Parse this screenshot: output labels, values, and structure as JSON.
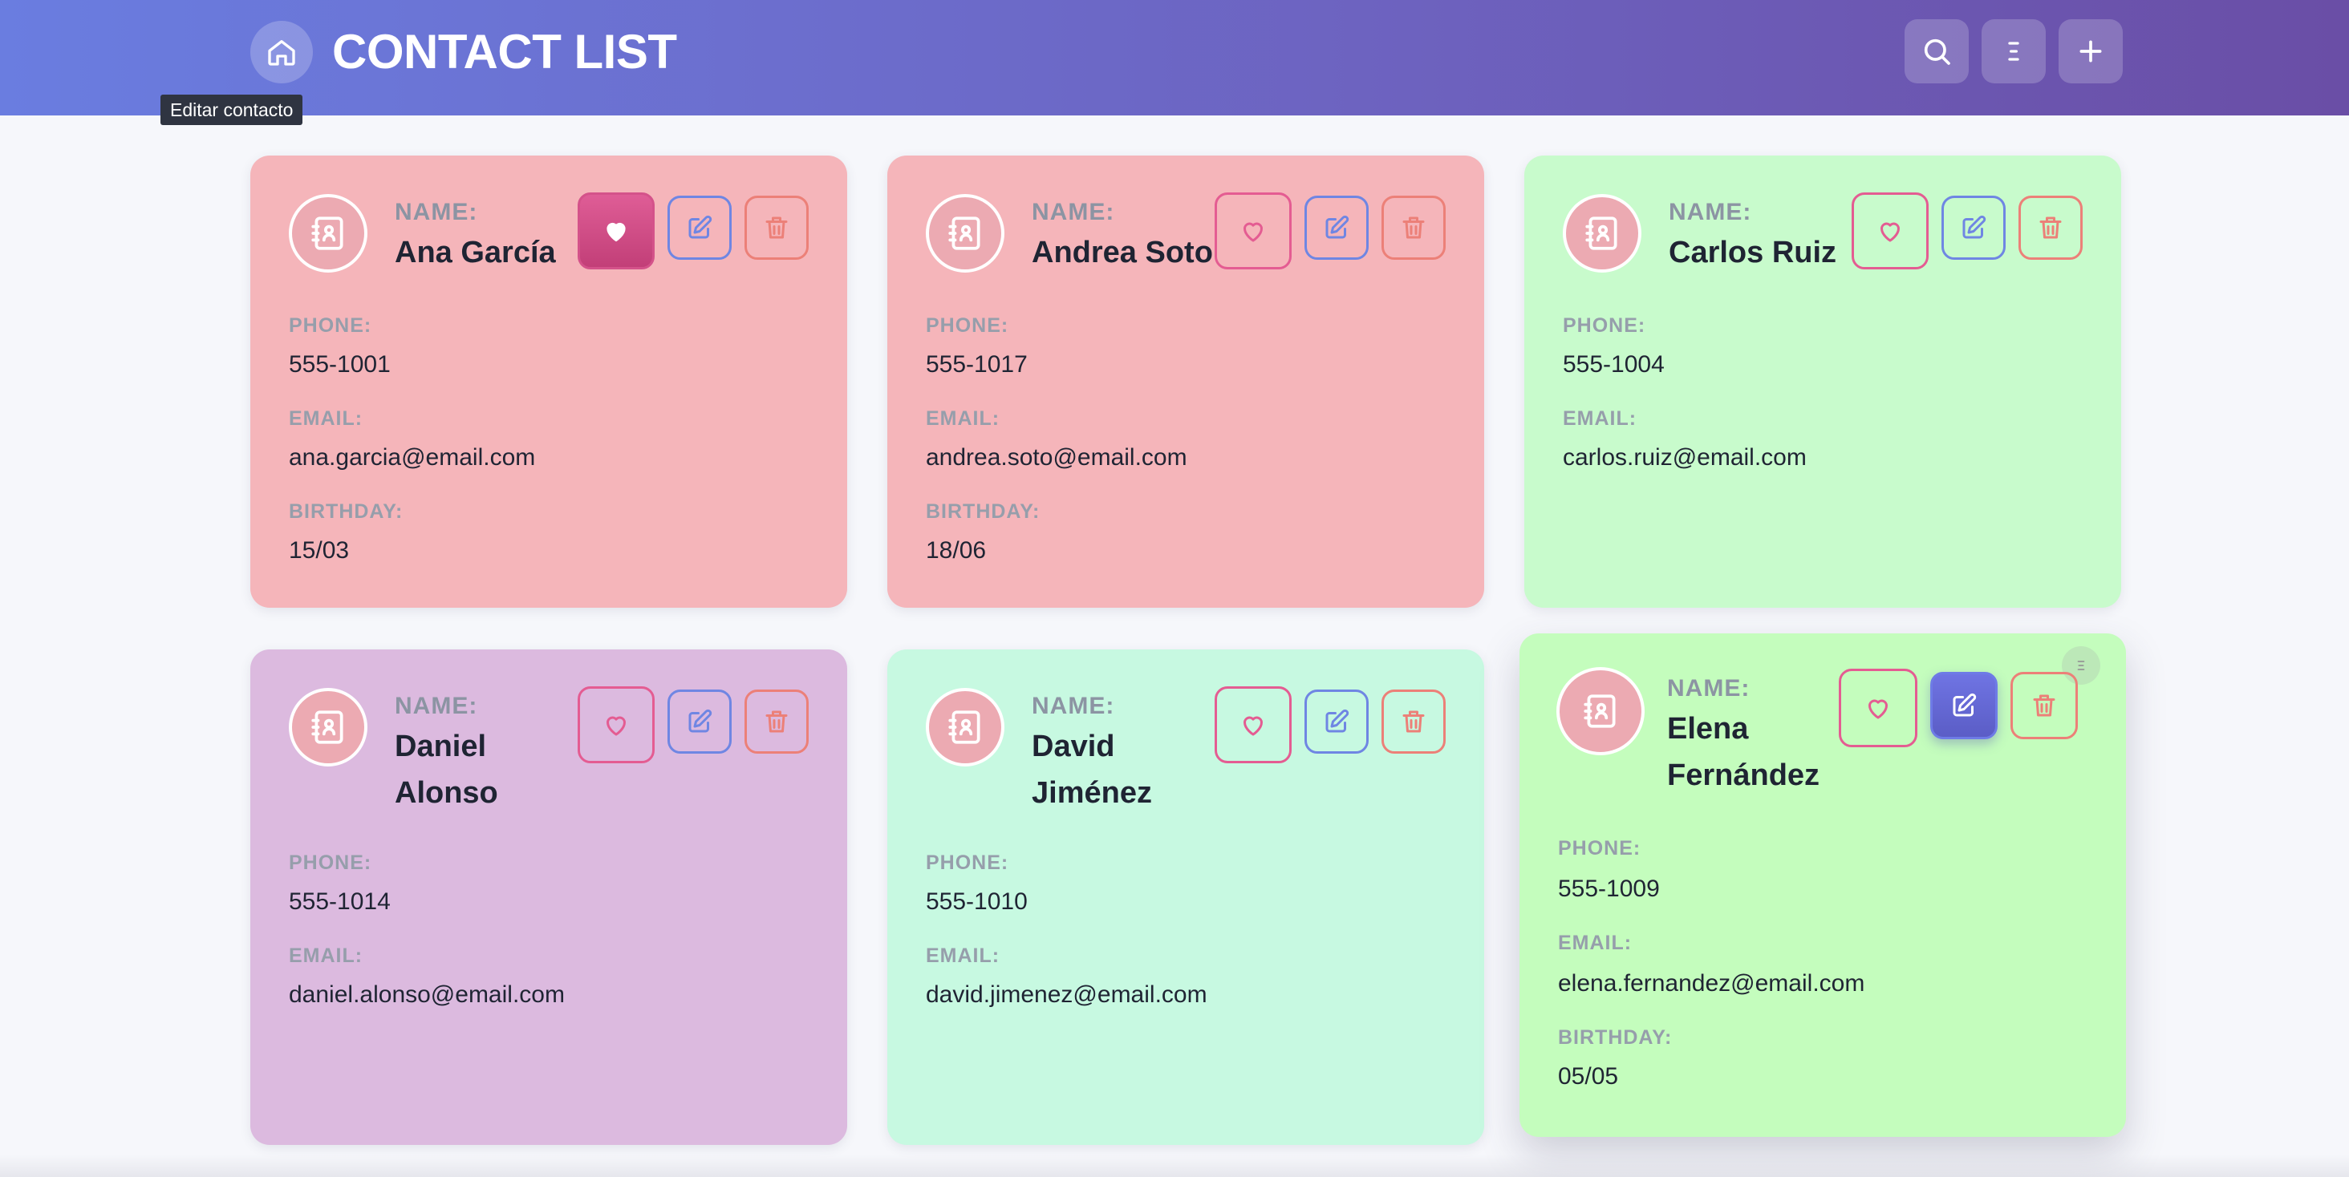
{
  "header": {
    "title": "CONTACT LIST",
    "home_icon": "home-icon",
    "tooltip": "Editar contacto",
    "actions": [
      {
        "name": "search-button",
        "icon": "search-icon"
      },
      {
        "name": "menu-button",
        "icon": "menu-icon"
      },
      {
        "name": "add-contact-button",
        "icon": "plus-icon"
      }
    ]
  },
  "labels": {
    "name": "NAME:",
    "phone": "PHONE:",
    "email": "EMAIL:",
    "birthday": "BIRTHDAY:"
  },
  "contacts": [
    {
      "name": "Ana García",
      "phone": "555-1001",
      "email": "ana.garcia@email.com",
      "birthday": "15/03",
      "favorite": true,
      "color": "#f5b5ba"
    },
    {
      "name": "Andrea Soto",
      "phone": "555-1017",
      "email": "andrea.soto@email.com",
      "birthday": "18/06",
      "favorite": false,
      "color": "#f5b5ba"
    },
    {
      "name": "Carlos Ruiz",
      "phone": "555-1004",
      "email": "carlos.ruiz@email.com",
      "birthday": "",
      "favorite": false,
      "color": "#c8fbcc"
    },
    {
      "name": "Daniel Alonso",
      "phone": "555-1014",
      "email": "daniel.alonso@email.com",
      "birthday": "",
      "favorite": false,
      "color": "#dcbadf"
    },
    {
      "name": "David Jiménez",
      "phone": "555-1010",
      "email": "david.jimenez@email.com",
      "birthday": "",
      "favorite": false,
      "color": "#c7f9e1"
    },
    {
      "name": "Elena Fernández",
      "phone": "555-1009",
      "email": "elena.fernandez@email.com",
      "birthday": "05/05",
      "favorite": false,
      "color": "#c4fdbd"
    }
  ],
  "colors": {
    "header_start": "#6a7de0",
    "header_end": "#6a4ea6",
    "favorite": "#e45c92",
    "edit": "#6f86e3",
    "delete": "#ec8078"
  }
}
